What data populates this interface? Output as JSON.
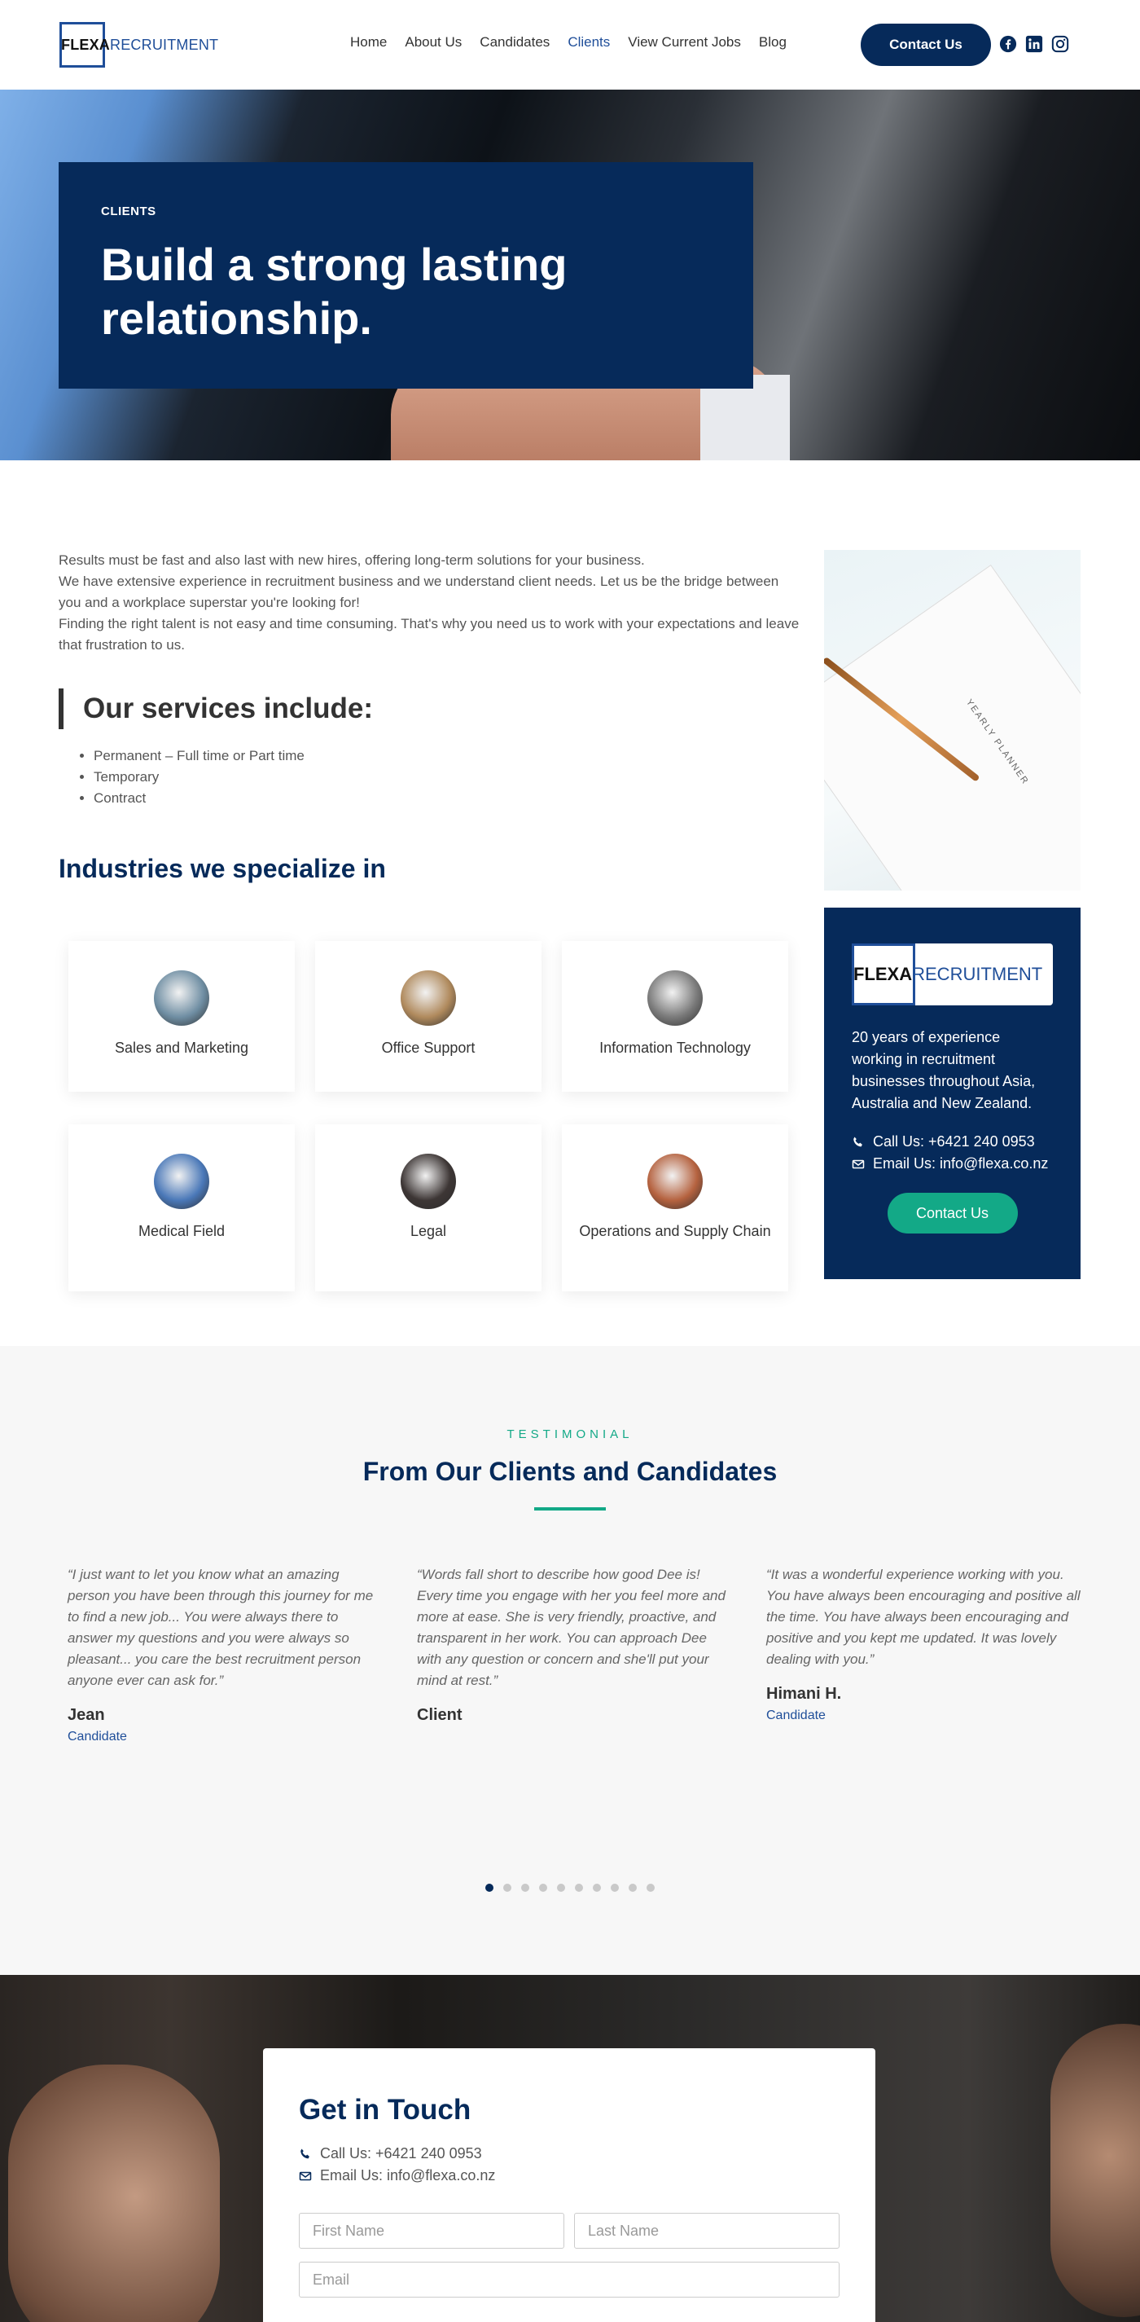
{
  "brand": {
    "logo_part1": "FLEXA",
    "logo_part2": "RECRUITMENT"
  },
  "nav": {
    "items": [
      "Home",
      "About Us",
      "Candidates",
      "Clients",
      "View Current Jobs",
      "Blog"
    ],
    "active": "Clients",
    "contact_label": "Contact Us"
  },
  "hero": {
    "eyebrow": "CLIENTS",
    "title": "Build a strong lasting relationship."
  },
  "intro": {
    "p1": "Results must be fast and also last with new hires, offering long-term solutions for your business.",
    "p2": "We have extensive experience in recruitment business and we understand client needs. Let us be the bridge between you and a workplace superstar you're looking for!",
    "p3": "Finding the right talent is not easy and time consuming. That's why you need us to work with your expectations and leave that frustration to us."
  },
  "services": {
    "title": "Our services include:",
    "items": [
      "Permanent – Full time or Part time",
      "Temporary",
      "Contract"
    ]
  },
  "industries": {
    "title": "Industries we specialize in",
    "items": [
      {
        "label": "Sales and Marketing",
        "color": "#6f8ea3"
      },
      {
        "label": "Office Support",
        "color": "#b08a5d"
      },
      {
        "label": "Information Technology",
        "color": "#7a7a7a"
      },
      {
        "label": "Medical Field",
        "color": "#4a78b8"
      },
      {
        "label": "Legal",
        "color": "#3d3635"
      },
      {
        "label": "Operations and Supply Chain",
        "color": "#b5623f"
      }
    ]
  },
  "sidebar": {
    "planner_text": "YEARLY PLANNER",
    "desc": "20 years of experience working in recruitment businesses throughout Asia, Australia and New Zealand.",
    "phone": "Call Us: +6421 240 0953",
    "email": "Email Us: info@flexa.co.nz",
    "button": "Contact Us"
  },
  "testimonials": {
    "eyebrow": "TESTIMONIAL",
    "title": "From Our Clients and Candidates",
    "items": [
      {
        "quote": "“I just want to let you know what an amazing person you have been through this journey for me to find a new job... You were always there to answer my questions and you were always so pleasant... you care the best recruitment person anyone ever can ask for.”",
        "name": "Jean",
        "role": "Candidate"
      },
      {
        "quote": "“Words fall short to describe how good Dee is! Every time you engage with her you feel more and more at ease. She is very friendly, proactive, and transparent in her work. You can approach Dee with any question or concern and she'll put your mind at rest.”",
        "name": "Client",
        "role": ""
      },
      {
        "quote": "“It was a wonderful experience working with you. You have always been encouraging and positive all the time. You have always been encouraging and positive and you kept me updated. It was lovely dealing with you.”",
        "name": "Himani H.",
        "role": "Candidate"
      }
    ],
    "dots_total": 10,
    "dots_active": 0
  },
  "get_in_touch": {
    "title": "Get in Touch",
    "phone": "Call Us: +6421 240 0953",
    "email": "Email Us: info@flexa.co.nz",
    "first_name_placeholder": "First Name",
    "last_name_placeholder": "Last Name",
    "email_placeholder": "Email"
  },
  "colors": {
    "navy": "#062a5a",
    "green": "#13a987",
    "brand_blue": "#1f4e99"
  }
}
